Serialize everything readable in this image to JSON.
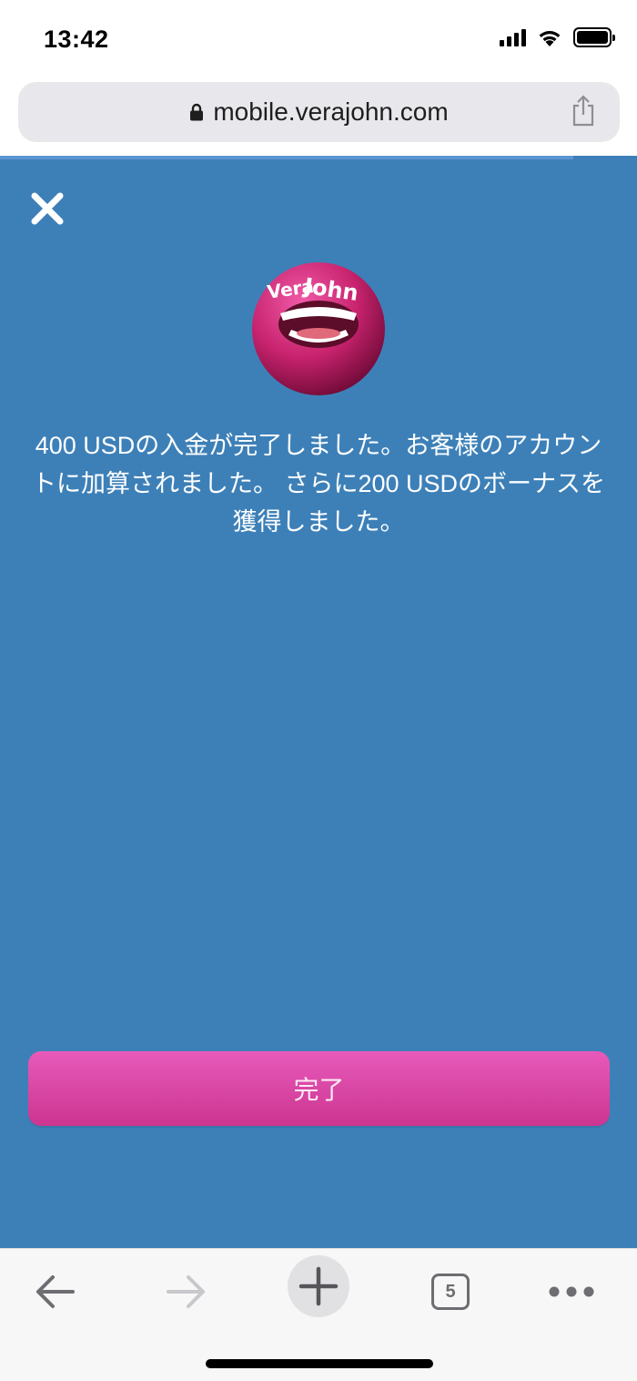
{
  "status_bar": {
    "time": "13:42"
  },
  "browser": {
    "url": "mobile.verajohn.com",
    "tab_count": "5"
  },
  "modal": {
    "message": "400 USDの入金が完了しました。お客様のアカウントに加算されました。 さらに200 USDのボーナスを獲得しました。",
    "done_label": "完了",
    "mascot_text": "Vera&John"
  },
  "colors": {
    "modal_background": "#3d80b8",
    "button_pink": "#d83d9e",
    "mascot_pink": "#c8236e"
  }
}
